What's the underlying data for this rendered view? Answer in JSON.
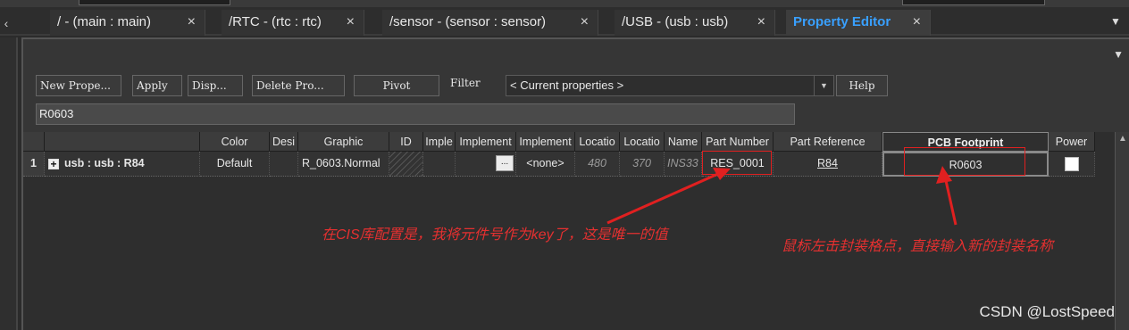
{
  "tabs": [
    {
      "label": "/ - (main : main)",
      "close": "×",
      "active": false
    },
    {
      "label": "/RTC - (rtc : rtc)",
      "close": "×",
      "active": false
    },
    {
      "label": "/sensor - (sensor : sensor)",
      "close": "×",
      "active": false
    },
    {
      "label": "/USB - (usb : usb)",
      "close": "×",
      "active": false
    },
    {
      "label": "Property Editor",
      "close": "×",
      "active": true
    }
  ],
  "toolbar": {
    "new_property": "New Prope...",
    "apply": "Apply",
    "display": "Disp...",
    "delete_property": "Delete Pro...",
    "pivot": "Pivot",
    "filter_label": "Filter",
    "filter_value": "< Current properties >",
    "help": "Help"
  },
  "value_field": "R0603",
  "grid": {
    "headers": [
      "",
      "",
      "Color",
      "Desi",
      "Graphic",
      "ID",
      "Imple",
      "Implement",
      "Implement",
      "Locatio",
      "Locatio",
      "Name",
      "Part Number",
      "Part Reference",
      "PCB Footprint",
      "Power"
    ],
    "row": {
      "number": "1",
      "expander": "+",
      "component": "usb : usb : R84",
      "color": "Default",
      "designator": "",
      "graphic": "R_0603.Normal",
      "implementation_btn": "...",
      "implementation_type": "<none>",
      "location_x": "480",
      "location_y": "370",
      "name": "INS33",
      "part_number": "RES_0001",
      "part_reference": "R84",
      "pcb_footprint": "R0603",
      "power_checked": false
    }
  },
  "annotations": {
    "left": "在CIS库配置是，我将元件号作为key了，这是唯一的值",
    "right": "鼠标左击封装格点，直接输入新的封装名称"
  },
  "watermark": "CSDN @LostSpeed",
  "colors": {
    "active_tab": "#39a0ff",
    "annotation": "#e53030"
  }
}
